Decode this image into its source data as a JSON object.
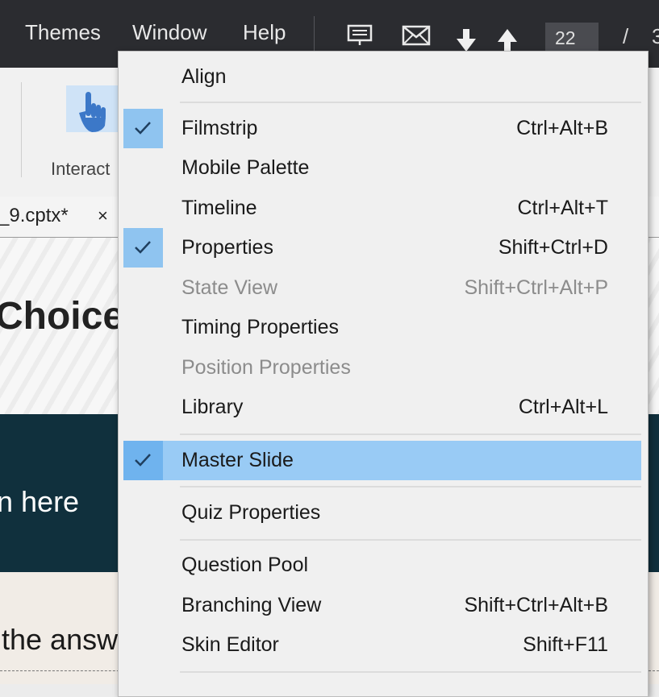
{
  "menubar": {
    "items": [
      "Themes",
      "Window",
      "Help"
    ],
    "page_number": "22",
    "page_slash": "/",
    "page_total": "3"
  },
  "ribbon": {
    "interactions_label": "Interact"
  },
  "tab": {
    "filename": "_9.cptx*",
    "close": "×"
  },
  "slide": {
    "title": "Choice",
    "banner_text": "n here",
    "question_text": "the answ"
  },
  "window_menu": {
    "items": [
      {
        "label": "Align",
        "shortcut": "",
        "checked": false,
        "disabled": false
      },
      {
        "label": "Filmstrip",
        "shortcut": "Ctrl+Alt+B",
        "checked": true,
        "disabled": false
      },
      {
        "label": "Mobile Palette",
        "shortcut": "",
        "checked": false,
        "disabled": false
      },
      {
        "label": "Timeline",
        "shortcut": "Ctrl+Alt+T",
        "checked": false,
        "disabled": false
      },
      {
        "label": "Properties",
        "shortcut": "Shift+Ctrl+D",
        "checked": true,
        "disabled": false
      },
      {
        "label": "State View",
        "shortcut": "Shift+Ctrl+Alt+P",
        "checked": false,
        "disabled": true
      },
      {
        "label": "Timing Properties",
        "shortcut": "",
        "checked": false,
        "disabled": false
      },
      {
        "label": "Position Properties",
        "shortcut": "",
        "checked": false,
        "disabled": true
      },
      {
        "label": "Library",
        "shortcut": "Ctrl+Alt+L",
        "checked": false,
        "disabled": false
      },
      {
        "label": "Master Slide",
        "shortcut": "",
        "checked": true,
        "disabled": false,
        "highlighted": true
      },
      {
        "label": "Quiz Properties",
        "shortcut": "",
        "checked": false,
        "disabled": false
      },
      {
        "label": "Question Pool",
        "shortcut": "",
        "checked": false,
        "disabled": false
      },
      {
        "label": "Branching View",
        "shortcut": "Shift+Ctrl+Alt+B",
        "checked": false,
        "disabled": false
      },
      {
        "label": "Skin Editor",
        "shortcut": "Shift+F11",
        "checked": false,
        "disabled": false
      }
    ]
  },
  "colors": {
    "menubar_bg": "#2b2c30",
    "menu_bg": "#f0f0f0",
    "highlight": "#99cbf5",
    "check_bg": "#8fc4f0",
    "banner": "#10303d"
  }
}
